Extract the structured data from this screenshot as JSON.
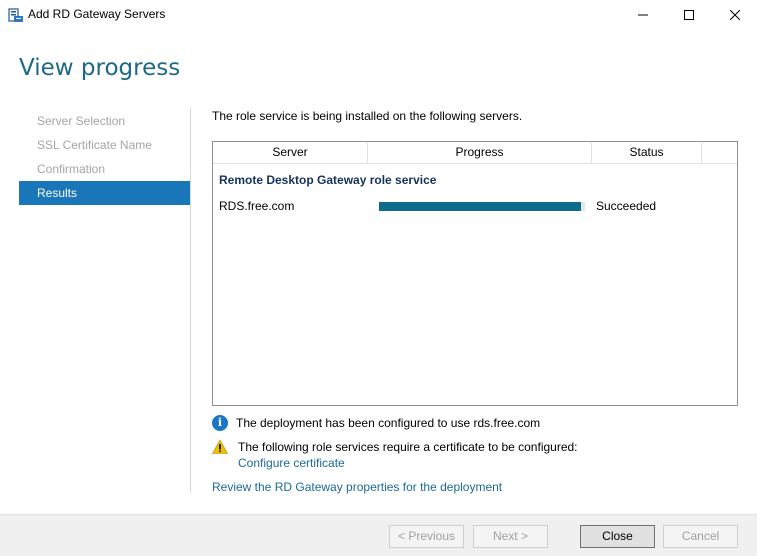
{
  "window": {
    "title": "Add RD Gateway Servers",
    "icons": {
      "app": "server-manager-icon",
      "minimize": "minimize-icon",
      "maximize": "maximize-icon",
      "close": "close-icon"
    }
  },
  "page": {
    "title": "View progress"
  },
  "nav": {
    "items": [
      {
        "label": "Server Selection",
        "state": "disabled"
      },
      {
        "label": "SSL Certificate Name",
        "state": "disabled"
      },
      {
        "label": "Confirmation",
        "state": "disabled"
      },
      {
        "label": "Results",
        "state": "active"
      }
    ]
  },
  "main": {
    "intro": "The role service is being installed on the following servers.",
    "table": {
      "columns": [
        "Server",
        "Progress",
        "Status"
      ],
      "group_title": "Remote Desktop Gateway role service",
      "rows": [
        {
          "server": "RDS.free.com",
          "progress": 0.98,
          "status": "Succeeded"
        }
      ]
    },
    "info_message": "The deployment has been configured to use rds.free.com",
    "warning_message": "The following role services require a certificate to be configured:",
    "configure_link": "Configure certificate",
    "review_link": "Review the RD Gateway properties for the deployment"
  },
  "footer": {
    "previous": "< Previous",
    "next": "Next >",
    "close": "Close",
    "cancel": "Cancel"
  },
  "colors": {
    "accent": "#1976b9",
    "title": "#1e6a86",
    "progress": "#0d6c8c",
    "link": "#1e6a96",
    "info": "#1976c8",
    "warning": "#f0c000"
  }
}
